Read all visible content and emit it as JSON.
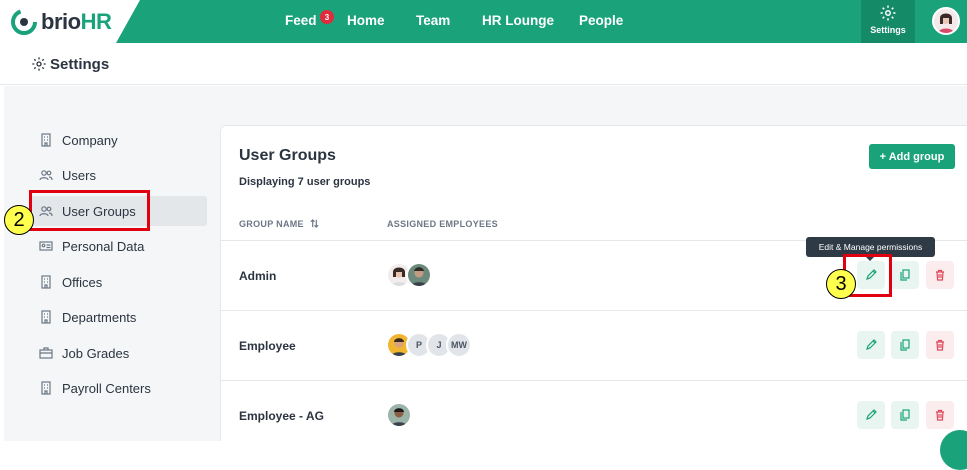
{
  "app": {
    "brand_main": "brio",
    "brand_accent": "HR"
  },
  "nav": {
    "items": [
      {
        "label": "Feed",
        "badge": "3"
      },
      {
        "label": "Home"
      },
      {
        "label": "Team"
      },
      {
        "label": "HR Lounge"
      },
      {
        "label": "People"
      }
    ],
    "settings_label": "Settings"
  },
  "page": {
    "title": "Settings"
  },
  "sidebar": {
    "items": [
      {
        "label": "Company",
        "icon": "building-icon"
      },
      {
        "label": "Users",
        "icon": "users-icon"
      },
      {
        "label": "User Groups",
        "icon": "users-icon",
        "active": true
      },
      {
        "label": "Personal Data",
        "icon": "id-card-icon"
      },
      {
        "label": "Offices",
        "icon": "building-icon"
      },
      {
        "label": "Departments",
        "icon": "building-icon"
      },
      {
        "label": "Job Grades",
        "icon": "briefcase-icon"
      },
      {
        "label": "Payroll Centers",
        "icon": "building-icon"
      }
    ]
  },
  "panel": {
    "title": "User Groups",
    "subtitle": "Displaying 7 user groups",
    "add_button": "+ Add group",
    "columns": [
      "GROUP NAME",
      "ASSIGNED EMPLOYEES"
    ],
    "tooltip": "Edit & Manage permissions",
    "rows": [
      {
        "name": "Admin",
        "initials": []
      },
      {
        "name": "Employee",
        "initials": [
          "P",
          "J",
          "MW"
        ]
      },
      {
        "name": "Employee - AG",
        "initials": []
      }
    ]
  },
  "annotations": {
    "callout_2": "2",
    "callout_3": "3"
  },
  "colors": {
    "brand": "#1aa37a",
    "annotation_red": "#e10010",
    "callout_yellow": "#ffff4d"
  }
}
